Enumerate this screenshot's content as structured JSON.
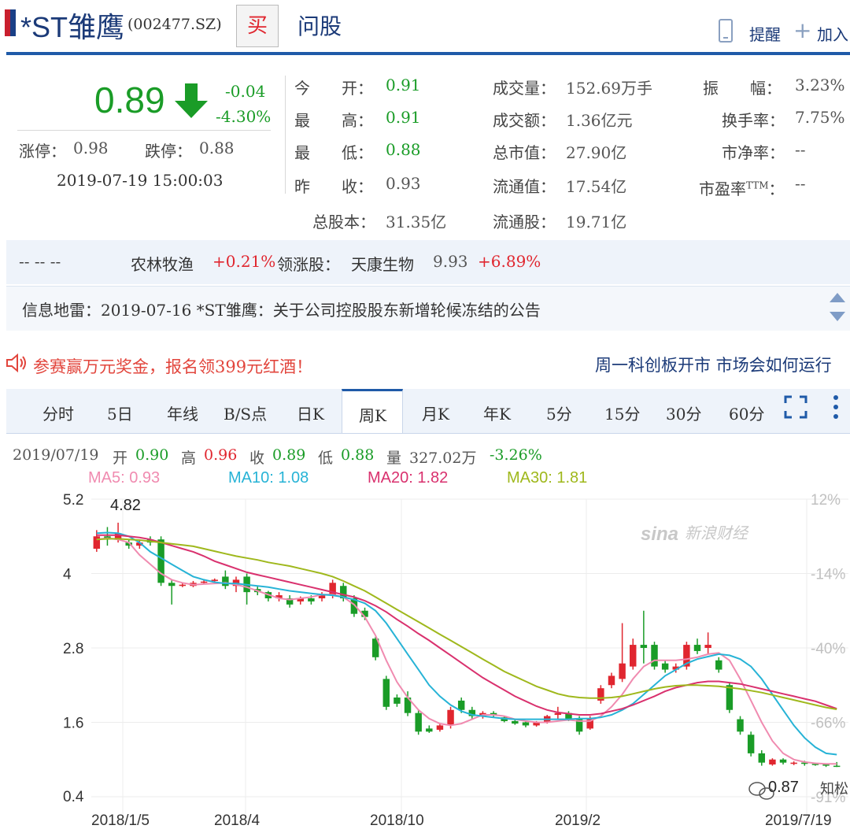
{
  "header": {
    "stock_name": "*ST雏鹰",
    "stock_code": "(002477.SZ)",
    "buy_label": "买",
    "ask_label": "问股",
    "remind_label": "提醒",
    "add_label": "加入",
    "flag_colors": [
      "#c91f2e",
      "#1a3f86"
    ]
  },
  "quote": {
    "price": "0.89",
    "change": "-0.04",
    "change_pct": "-4.30%",
    "limit_up_label": "涨停：",
    "limit_up": "0.98",
    "limit_down_label": "跌停：",
    "limit_down": "0.88",
    "time": "2019-07-19 15:00:03",
    "fields": {
      "open_label": "今　　开：",
      "open": "0.91",
      "high_label": "最　　高：",
      "high": "0.91",
      "low_label": "最　　低：",
      "low": "0.88",
      "prev_close_label": "昨　　收：",
      "prev_close": "0.93",
      "volume_label": "成交量：",
      "volume": "152.69万手",
      "turnover_label": "成交额：",
      "turnover": "1.36亿元",
      "market_cap_label": "总市值：",
      "market_cap": "27.90亿",
      "float_cap_label": "流通值：",
      "float_cap": "17.54亿",
      "amplitude_label": "振　　幅：",
      "amplitude": "3.23%",
      "turnover_rate_label": "换手率：",
      "turnover_rate": "7.75%",
      "pb_label": "市净率：",
      "pb": "--",
      "pe_label": "市盈率",
      "pe_sup": "TTM",
      "pe_colon": "：",
      "pe": "--",
      "total_shares_label": "总股本：",
      "total_shares": "31.35亿",
      "float_shares_label": "流通股：",
      "float_shares": "19.71亿"
    }
  },
  "sector": {
    "dashes": "-- -- --",
    "industry": "农林牧渔",
    "industry_chg": "+0.21%",
    "leader_label": "领涨股：",
    "leader_name": "天康生物",
    "leader_price": "9.93",
    "leader_chg": "+6.89%"
  },
  "info_mine": {
    "text": "信息地雷：2019-07-16 *ST雏鹰：关于公司控股股东新增轮候冻结的公告"
  },
  "promo": {
    "left": "参赛赢万元奖金，报名领399元红酒！",
    "right": "周一科创板开市 市场会如何运行"
  },
  "tabs": [
    "分时",
    "5日",
    "年线",
    "B/S点",
    "日K",
    "周K",
    "月K",
    "年K",
    "5分",
    "15分",
    "30分",
    "60分"
  ],
  "active_tab": "周K",
  "bar_info": {
    "date": "2019/07/19",
    "open_label": "开",
    "open": "0.90",
    "high_label": "高",
    "high": "0.96",
    "close_label": "收",
    "close": "0.89",
    "low_label": "低",
    "low": "0.88",
    "vol_label": "量",
    "vol": "327.02万",
    "chg": "-3.26%"
  },
  "ma_legend": [
    {
      "label": "MA5: 0.93",
      "color": "#f08bb0"
    },
    {
      "label": "MA10: 1.08",
      "color": "#27b3d6"
    },
    {
      "label": "MA20: 1.82",
      "color": "#d9316e"
    },
    {
      "label": "MA30: 1.81",
      "color": "#9fb81c"
    }
  ],
  "watermark": "新浪财经",
  "watermark_logo": "sina",
  "wechat_mark": "知松",
  "chart_data": {
    "type": "candlestick",
    "y_ticks": [
      "5.2",
      "4",
      "2.8",
      "1.6",
      "0.4"
    ],
    "y_range": [
      0.4,
      5.2
    ],
    "pct_ticks": [
      "12%",
      "-14%",
      "-40%",
      "-66%",
      "-91%"
    ],
    "x_labels": [
      "2018/1/5",
      "2018/4",
      "2018/10",
      "2019/2",
      "2019/7/19"
    ],
    "max_label": "4.82",
    "min_label": "0.87",
    "colors": {
      "up": "#e0262f",
      "down": "#1a9c27"
    },
    "candles": [
      [
        4.4,
        4.6,
        4.35,
        4.7
      ],
      [
        4.6,
        4.55,
        4.45,
        4.75
      ],
      [
        4.55,
        4.65,
        4.5,
        4.82
      ],
      [
        4.5,
        4.45,
        4.4,
        4.55
      ],
      [
        4.45,
        4.5,
        4.4,
        4.55
      ],
      [
        4.55,
        4.5,
        4.45,
        4.6
      ],
      [
        4.55,
        3.85,
        3.8,
        4.6
      ],
      [
        3.85,
        3.8,
        3.5,
        3.9
      ],
      [
        3.8,
        3.82,
        3.78,
        3.85
      ],
      [
        3.8,
        3.85,
        3.78,
        3.88
      ],
      [
        3.85,
        3.87,
        3.83,
        3.9
      ],
      [
        3.88,
        3.9,
        3.86,
        3.92
      ],
      [
        3.95,
        3.8,
        3.75,
        4.05
      ],
      [
        3.8,
        3.9,
        3.7,
        3.95
      ],
      [
        3.95,
        3.7,
        3.5,
        4.0
      ],
      [
        3.75,
        3.7,
        3.65,
        3.8
      ],
      [
        3.7,
        3.6,
        3.55,
        3.72
      ],
      [
        3.6,
        3.65,
        3.55,
        3.7
      ],
      [
        3.6,
        3.5,
        3.45,
        3.65
      ],
      [
        3.55,
        3.6,
        3.5,
        3.63
      ],
      [
        3.6,
        3.55,
        3.5,
        3.65
      ],
      [
        3.6,
        3.65,
        3.55,
        3.7
      ],
      [
        3.65,
        3.85,
        3.6,
        3.9
      ],
      [
        3.8,
        3.6,
        3.55,
        3.85
      ],
      [
        3.6,
        3.35,
        3.3,
        3.65
      ],
      [
        3.4,
        3.3,
        3.25,
        3.45
      ],
      [
        2.95,
        2.65,
        2.6,
        2.98
      ],
      [
        2.3,
        1.85,
        1.8,
        2.35
      ],
      [
        2.0,
        1.9,
        1.85,
        2.05
      ],
      [
        2.0,
        1.75,
        1.7,
        2.1
      ],
      [
        1.75,
        1.45,
        1.4,
        1.8
      ],
      [
        1.5,
        1.45,
        1.43,
        1.55
      ],
      [
        1.48,
        1.55,
        1.45,
        1.58
      ],
      [
        1.55,
        1.8,
        1.5,
        1.85
      ],
      [
        1.95,
        1.8,
        1.75,
        2.0
      ],
      [
        1.8,
        1.7,
        1.65,
        1.85
      ],
      [
        1.7,
        1.75,
        1.66,
        1.78
      ],
      [
        1.75,
        1.72,
        1.68,
        1.78
      ],
      [
        1.68,
        1.62,
        1.6,
        1.7
      ],
      [
        1.62,
        1.58,
        1.56,
        1.65
      ],
      [
        1.6,
        1.55,
        1.52,
        1.62
      ],
      [
        1.55,
        1.6,
        1.53,
        1.62
      ],
      [
        1.6,
        1.7,
        1.58,
        1.72
      ],
      [
        1.72,
        1.75,
        1.65,
        1.85
      ],
      [
        1.75,
        1.65,
        1.62,
        1.78
      ],
      [
        1.65,
        1.45,
        1.4,
        1.7
      ],
      [
        1.5,
        1.65,
        1.48,
        1.7
      ],
      [
        1.95,
        2.15,
        1.9,
        2.2
      ],
      [
        2.2,
        2.35,
        2.15,
        2.4
      ],
      [
        2.3,
        2.55,
        2.25,
        3.2
      ],
      [
        2.5,
        2.85,
        2.45,
        2.95
      ],
      [
        2.85,
        2.8,
        2.55,
        3.4
      ],
      [
        2.85,
        2.5,
        2.45,
        2.9
      ],
      [
        2.55,
        2.45,
        2.4,
        2.6
      ],
      [
        2.45,
        2.5,
        2.4,
        2.55
      ],
      [
        2.5,
        2.85,
        2.45,
        2.9
      ],
      [
        2.85,
        2.75,
        2.7,
        2.95
      ],
      [
        2.8,
        2.85,
        2.7,
        3.05
      ],
      [
        2.6,
        2.45,
        2.4,
        2.65
      ],
      [
        2.2,
        1.8,
        1.75,
        2.25
      ],
      [
        1.65,
        1.45,
        1.4,
        1.7
      ],
      [
        1.4,
        1.1,
        1.05,
        1.45
      ],
      [
        1.1,
        0.95,
        0.9,
        1.15
      ],
      [
        0.92,
        1.0,
        0.9,
        1.02
      ],
      [
        1.0,
        0.95,
        0.92,
        1.02
      ],
      [
        0.93,
        0.95,
        0.91,
        0.97
      ],
      [
        0.95,
        0.93,
        0.9,
        0.98
      ],
      [
        0.93,
        0.92,
        0.9,
        0.95
      ],
      [
        0.92,
        0.9,
        0.88,
        0.94
      ],
      [
        0.9,
        0.89,
        0.88,
        0.96
      ]
    ],
    "ma5": [
      4.55,
      4.57,
      4.55,
      4.5,
      4.3,
      4.15,
      4.0,
      3.9,
      3.85,
      3.82,
      3.83,
      3.84,
      3.85,
      3.82,
      3.78,
      3.72,
      3.66,
      3.6,
      3.58,
      3.6,
      3.62,
      3.66,
      3.66,
      3.62,
      3.5,
      3.3,
      3.0,
      2.6,
      2.25,
      2.0,
      1.8,
      1.66,
      1.58,
      1.55,
      1.58,
      1.65,
      1.72,
      1.72,
      1.7,
      1.65,
      1.62,
      1.6,
      1.6,
      1.62,
      1.64,
      1.62,
      1.62,
      1.7,
      1.85,
      2.05,
      2.3,
      2.5,
      2.6,
      2.6,
      2.6,
      2.62,
      2.65,
      2.7,
      2.72,
      2.6,
      2.3,
      1.95,
      1.6,
      1.3,
      1.1,
      1.0,
      0.96,
      0.94,
      0.93,
      0.93
    ],
    "ma10": [
      4.65,
      4.66,
      4.65,
      4.6,
      4.5,
      4.35,
      4.25,
      4.15,
      4.05,
      3.95,
      3.9,
      3.86,
      3.84,
      3.84,
      3.82,
      3.8,
      3.78,
      3.75,
      3.72,
      3.7,
      3.68,
      3.66,
      3.65,
      3.62,
      3.58,
      3.52,
      3.4,
      3.2,
      2.95,
      2.7,
      2.45,
      2.2,
      2.02,
      1.88,
      1.78,
      1.72,
      1.7,
      1.68,
      1.66,
      1.65,
      1.65,
      1.65,
      1.65,
      1.65,
      1.65,
      1.66,
      1.66,
      1.68,
      1.72,
      1.8,
      1.9,
      2.05,
      2.2,
      2.35,
      2.45,
      2.55,
      2.62,
      2.66,
      2.7,
      2.68,
      2.62,
      2.5,
      2.3,
      2.05,
      1.8,
      1.55,
      1.35,
      1.2,
      1.1,
      1.08
    ],
    "ma20": [
      4.62,
      4.62,
      4.62,
      4.6,
      4.58,
      4.55,
      4.5,
      4.45,
      4.4,
      4.35,
      4.28,
      4.2,
      4.14,
      4.08,
      4.02,
      3.98,
      3.94,
      3.9,
      3.86,
      3.82,
      3.78,
      3.74,
      3.7,
      3.66,
      3.62,
      3.56,
      3.48,
      3.38,
      3.26,
      3.15,
      3.03,
      2.92,
      2.8,
      2.68,
      2.56,
      2.44,
      2.32,
      2.22,
      2.12,
      2.02,
      1.94,
      1.86,
      1.8,
      1.76,
      1.74,
      1.72,
      1.72,
      1.74,
      1.78,
      1.82,
      1.88,
      1.95,
      2.02,
      2.1,
      2.16,
      2.2,
      2.24,
      2.26,
      2.26,
      2.24,
      2.22,
      2.18,
      2.14,
      2.1,
      2.06,
      2.02,
      1.98,
      1.94,
      1.88,
      1.82
    ],
    "ma30": [
      4.55,
      4.56,
      4.56,
      4.55,
      4.54,
      4.52,
      4.5,
      4.48,
      4.46,
      4.44,
      4.4,
      4.36,
      4.32,
      4.28,
      4.25,
      4.22,
      4.18,
      4.15,
      4.12,
      4.08,
      4.04,
      4.0,
      3.95,
      3.88,
      3.8,
      3.72,
      3.62,
      3.52,
      3.42,
      3.32,
      3.22,
      3.12,
      3.02,
      2.92,
      2.82,
      2.72,
      2.62,
      2.52,
      2.42,
      2.34,
      2.26,
      2.18,
      2.12,
      2.06,
      2.02,
      2.0,
      1.99,
      1.99,
      2.0,
      2.02,
      2.06,
      2.1,
      2.14,
      2.17,
      2.19,
      2.2,
      2.2,
      2.19,
      2.18,
      2.16,
      2.14,
      2.11,
      2.08,
      2.04,
      2.0,
      1.96,
      1.92,
      1.88,
      1.84,
      1.81
    ]
  }
}
